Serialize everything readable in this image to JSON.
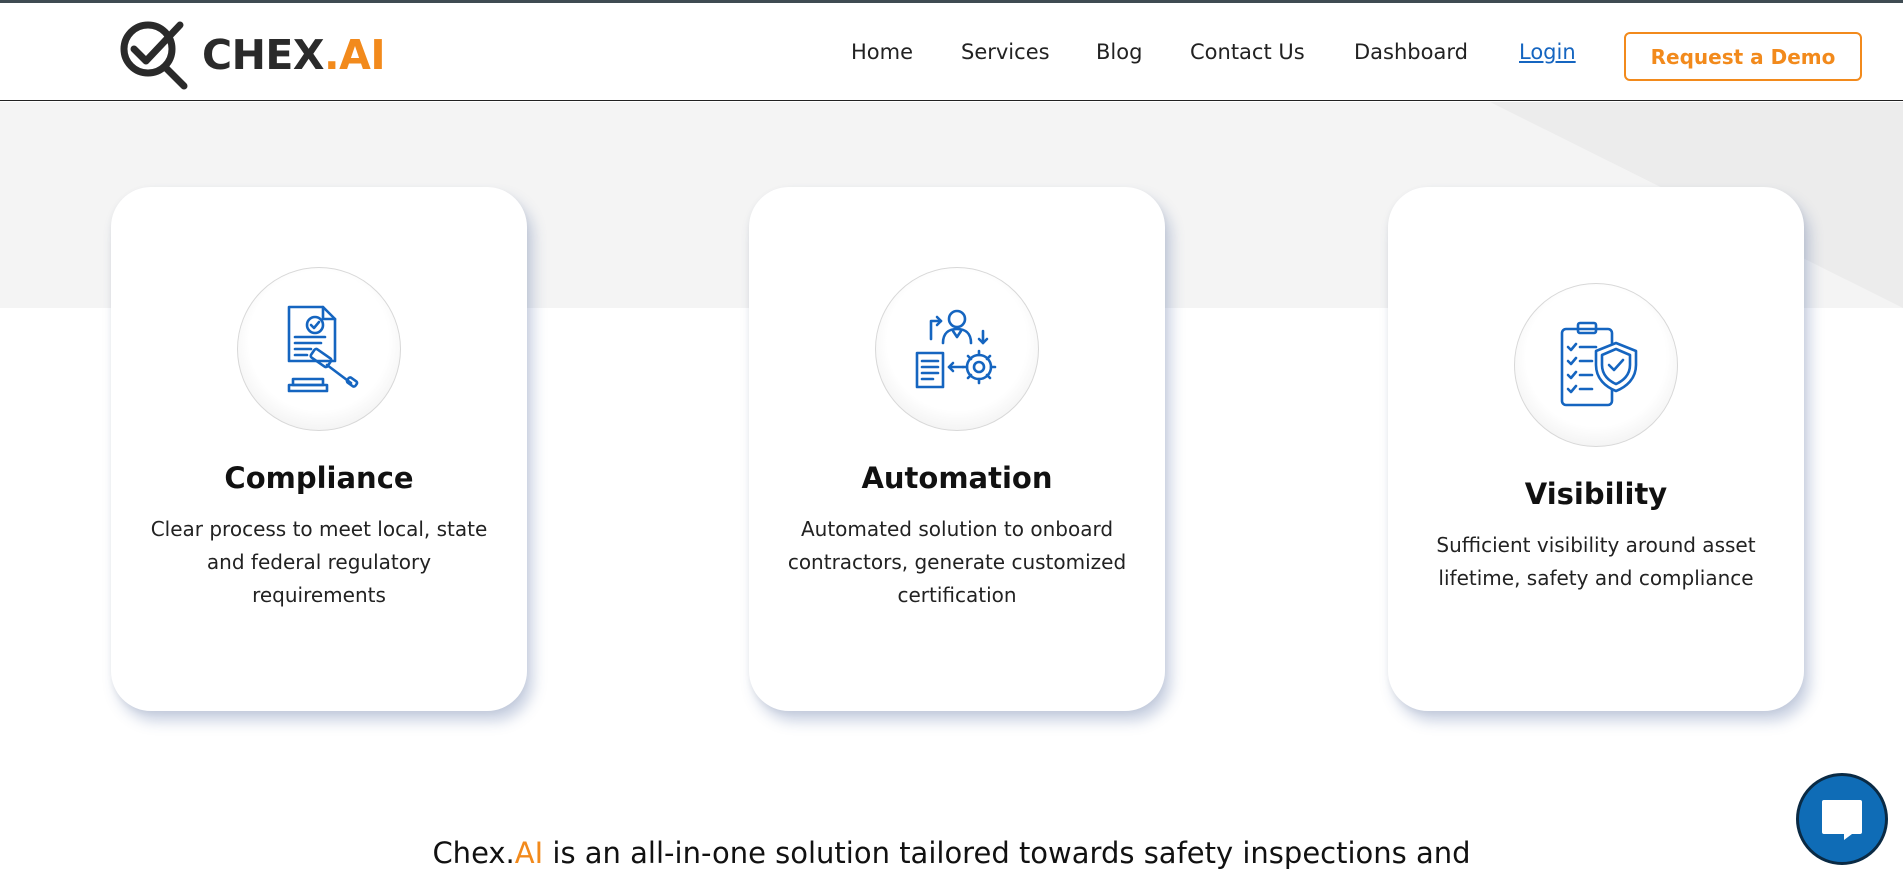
{
  "header": {
    "logo_brand": "CHEX",
    "logo_accent": ".AI",
    "logo_icon": "check-magnifier-icon",
    "nav": {
      "home": "Home",
      "services": "Services",
      "blog": "Blog",
      "contact": "Contact Us",
      "dashboard": "Dashboard",
      "login": "Login"
    },
    "cta_label": "Request a Demo"
  },
  "cards": [
    {
      "icon": "document-gavel-icon",
      "title": "Compliance",
      "description": "Clear process to meet local, state and federal regulatory requirements"
    },
    {
      "icon": "person-document-gear-icon",
      "title": "Automation",
      "description": "Automated solution to onboard contractors, generate customized certification"
    },
    {
      "icon": "clipboard-shield-icon",
      "title": "Visibility",
      "description": "Sufficient visibility around asset lifetime, safety and compliance"
    }
  ],
  "tagline": {
    "brand": "Chex.",
    "brand_accent": "AI",
    "rest": " is an all-in-one solution tailored towards safety inspections and"
  },
  "chat": {
    "icon": "chat-bubble-icon"
  },
  "colors": {
    "accent_orange": "#f28a1c",
    "icon_blue": "#1565c0",
    "chat_blue": "#0f6cb6",
    "band_gray": "#f4f4f4"
  }
}
